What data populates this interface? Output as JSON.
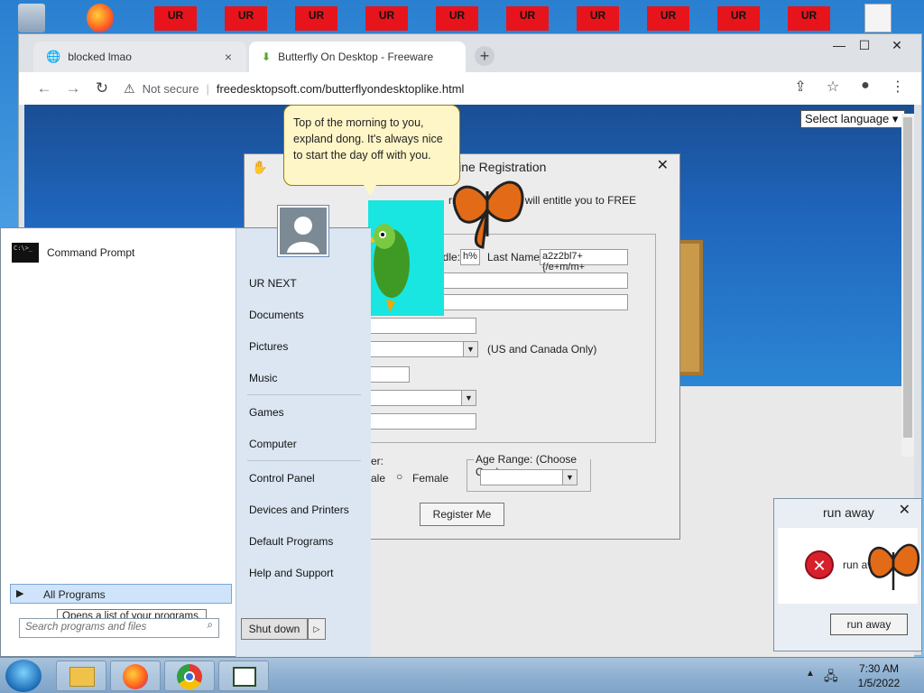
{
  "desktop": {
    "ur_boxes": [
      "UR",
      "UR",
      "UR",
      "UR",
      "UR",
      "UR",
      "UR",
      "UR",
      "UR",
      "UR"
    ]
  },
  "browser": {
    "tabs": [
      {
        "title": "blocked lmao",
        "close": "×"
      },
      {
        "title": "Butterfly On Desktop - Freeware",
        "close": "×"
      }
    ],
    "new_tab": "+",
    "window_controls": {
      "minimize": "—",
      "maximize": "☐",
      "close": "✕"
    },
    "nav": {
      "back": "←",
      "forward": "→",
      "reload": "↻"
    },
    "address": {
      "security_label": "Not secure",
      "url": "freedesktopsoft.com/butterflyondesktoplike.html"
    }
  },
  "page": {
    "language_select": "Select language ▾",
    "registration_dialog": {
      "title": "line Registration",
      "close": "✕",
      "intro": "rmation bel     this will entitle you to FREE",
      "middle_label": "ddle:",
      "middle_value": "h%",
      "last_name_label": "Last Name:",
      "last_name_value": "a2z2bl7+{/e+m/m+",
      "us_canada_note": "(US and Canada Only)",
      "gender_label": "er:",
      "male_label": "ale",
      "female_label": "Female",
      "age_range_label": "Age Range: (Choose One)",
      "register_button": "Register Me"
    },
    "speech_bubble": "Top of the morning to you, expland dong. It's always nice to start the day off with you."
  },
  "start_menu": {
    "pinned": [
      {
        "label": "Command Prompt"
      }
    ],
    "right_items": [
      "UR NEXT",
      "Documents",
      "Pictures",
      "Music",
      "Games",
      "Computer",
      "Control Panel",
      "Devices and Printers",
      "Default Programs",
      "Help and Support"
    ],
    "all_programs": "All Programs",
    "tooltip": "Opens a list of your programs.",
    "search_placeholder": "Search programs and files",
    "shutdown": "Shut down",
    "shutdown_arrow": "▷"
  },
  "run_away_dialog": {
    "title": "run away",
    "close": "✕",
    "message": "run away",
    "button": "run away"
  },
  "taskbar": {
    "time": "7:30 AM",
    "date": "1/5/2022"
  }
}
